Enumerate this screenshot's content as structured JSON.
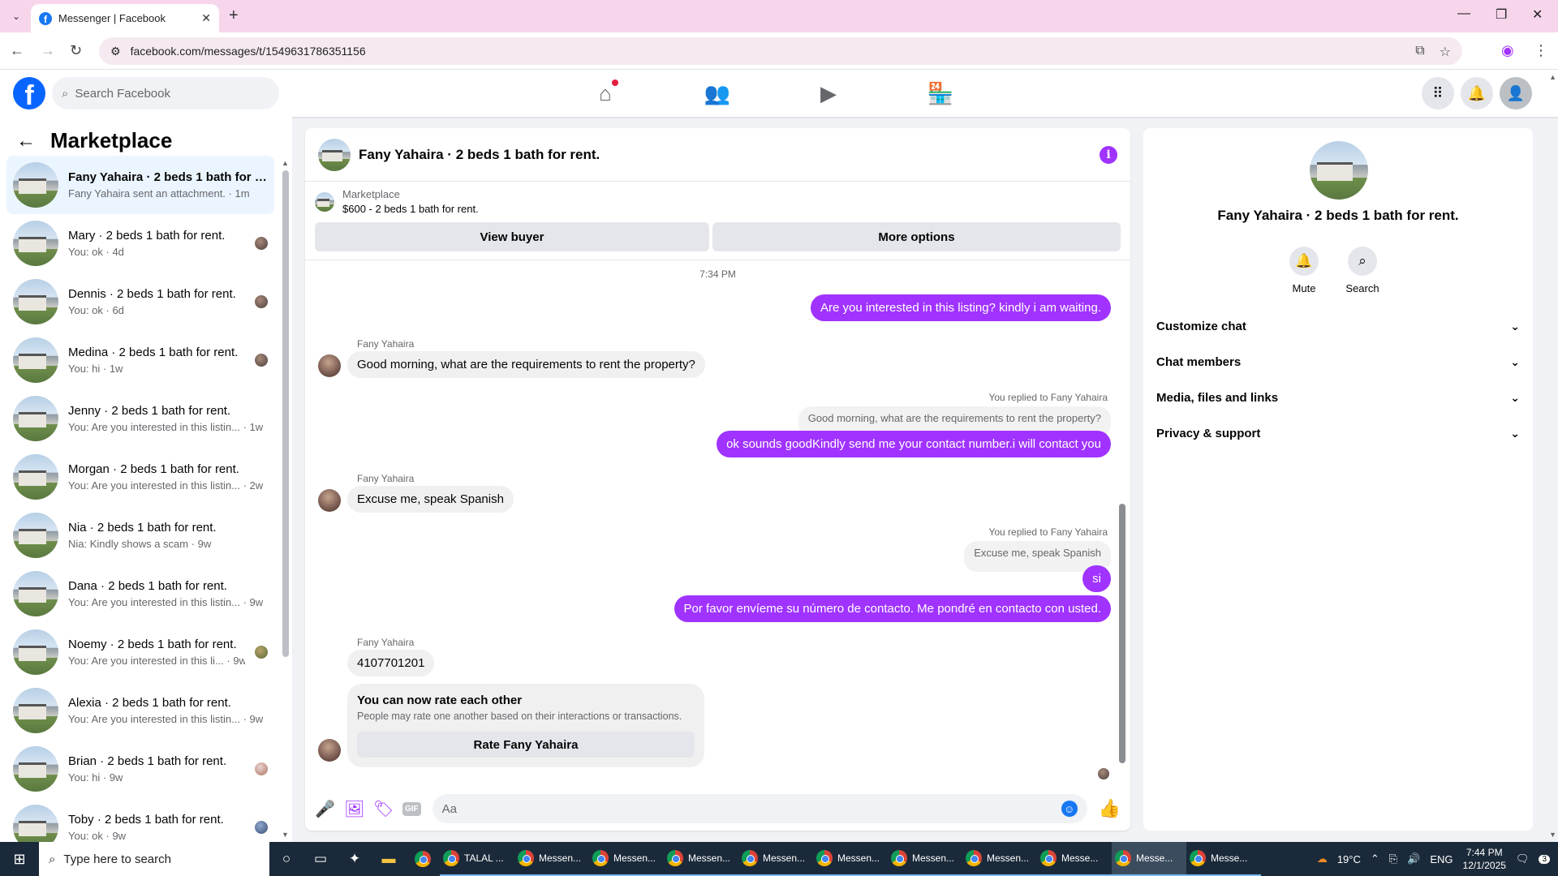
{
  "browser": {
    "tab_title": "Messenger | Facebook",
    "url": "facebook.com/messages/t/1549631786351156"
  },
  "fb": {
    "search_placeholder": "Search Facebook"
  },
  "left": {
    "title": "Marketplace",
    "conversations": [
      {
        "name": "Fany Yahaira · 2 beds 1 bath for r...",
        "snippet": "Fany Yahaira sent an attachment. · 1m"
      },
      {
        "name": "Mary · 2 beds 1 bath for rent.",
        "snippet": "You: ok · 4d"
      },
      {
        "name": "Dennis · 2 beds 1 bath for rent.",
        "snippet": "You: ok · 6d"
      },
      {
        "name": "Medina · 2 beds 1 bath for rent.",
        "snippet": "You: hi · 1w"
      },
      {
        "name": "Jenny · 2 beds 1 bath for rent.",
        "snippet": "You: Are you interested in this listin... · 1w"
      },
      {
        "name": "Morgan · 2 beds 1 bath for rent.",
        "snippet": "You: Are you interested in this listin... · 2w"
      },
      {
        "name": "Nia · 2 beds 1 bath for rent.",
        "snippet": "Nia: Kindly shows a scam · 9w"
      },
      {
        "name": "Dana · 2 beds 1 bath for rent.",
        "snippet": "You: Are you interested in this listin... · 9w"
      },
      {
        "name": "Noemy · 2 beds 1 bath for rent.",
        "snippet": "You: Are you interested in this li... · 9w"
      },
      {
        "name": "Alexia · 2 beds 1 bath for rent.",
        "snippet": "You: Are you interested in this listin... · 9w"
      },
      {
        "name": "Brian · 2 beds 1 bath for rent.",
        "snippet": "You: hi · 9w"
      },
      {
        "name": "Toby · 2 beds 1 bath for rent.",
        "snippet": "You: ok · 9w"
      }
    ]
  },
  "chat": {
    "title": "Fany Yahaira · 2 beds 1 bath for rent.",
    "listing_category": "Marketplace",
    "listing_desc": "$600 - 2 beds 1 bath for rent.",
    "view_buyer": "View buyer",
    "more_options": "More options",
    "time": "7:34 PM",
    "msg1": "Are you interested in this listing? kindly i am waiting.",
    "sender": "Fany Yahaira",
    "msg2": "Good morning, what are the requirements to rent the property?",
    "replied": "You replied to Fany Yahaira",
    "quote1": "Good morning, what are the requirements to rent the property?",
    "msg3": "ok sounds goodKindly send me your contact number.i will contact you",
    "msg4": "Excuse me, speak Spanish",
    "quote2": "Excuse me, speak Spanish",
    "msg5": "si",
    "msg6": "Por favor envíeme su número de contacto. Me pondré en contacto con usted.",
    "msg7": "4107701201",
    "rate_title": "You can now rate each other",
    "rate_sub": "People may rate one another based on their interactions or transactions.",
    "rate_btn": "Rate Fany Yahaira",
    "composer_placeholder": "Aa",
    "gif_label": "GIF"
  },
  "right": {
    "name": "Fany Yahaira · 2 beds 1 bath for rent.",
    "mute": "Mute",
    "search": "Search",
    "rows": [
      "Customize chat",
      "Chat members",
      "Media, files and links",
      "Privacy & support"
    ]
  },
  "taskbar": {
    "search_placeholder": "Type here to search",
    "apps": [
      "TALAL ...",
      "Messen...",
      "Messen...",
      "Messen...",
      "Messen...",
      "Messen...",
      "Messen...",
      "Messen...",
      "Messe...",
      "Messe...",
      "Messe..."
    ],
    "weather": "19°C",
    "lang": "ENG",
    "time": "7:44 PM",
    "date": "12/1/2025",
    "notif_count": "3"
  }
}
